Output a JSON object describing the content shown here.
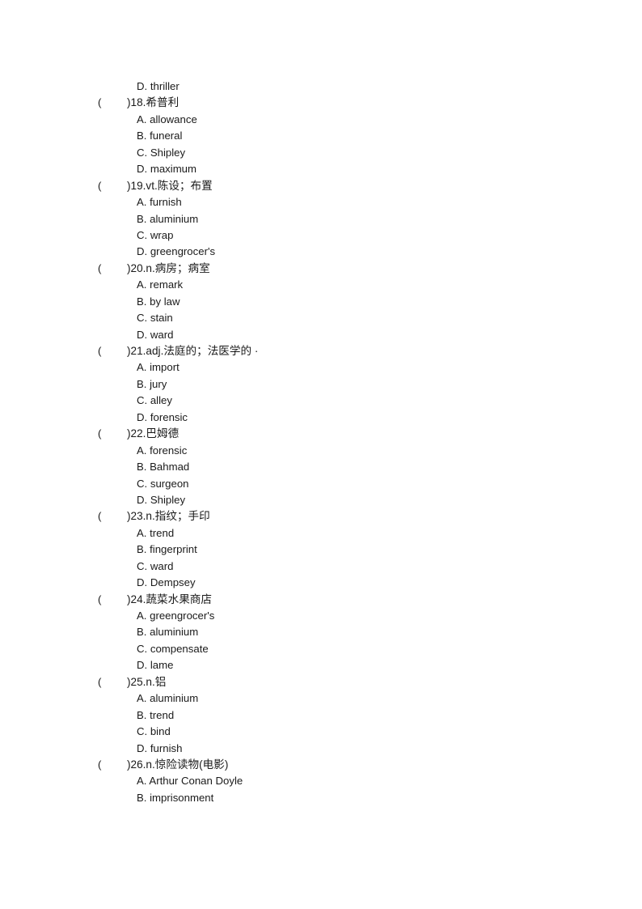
{
  "document": {
    "type": "vocabulary-multiple-choice-worksheet",
    "page_background": "#ffffff",
    "text_color": "#1a1a1a",
    "orphan_option": {
      "label": "D.",
      "text": "D. thriller"
    },
    "questions": [
      {
        "paren_open": "(",
        "paren_close": ")",
        "number": "18.",
        "pos": "",
        "prompt": "希普利",
        "stem": ")18.希普利",
        "options": [
          "A. allowance",
          "B. funeral",
          "C. Shipley",
          "D. maximum"
        ]
      },
      {
        "paren_open": "(",
        "paren_close": ")",
        "number": "19.",
        "pos": "vt.",
        "prompt": "陈设；布置",
        "stem": ")19.vt.陈设；布置",
        "options": [
          "A. furnish",
          "B. aluminium",
          "C. wrap",
          "D. greengrocer's"
        ]
      },
      {
        "paren_open": "(",
        "paren_close": ")",
        "number": "20.",
        "pos": "n.",
        "prompt": "病房；病室",
        "stem": ")20.n.病房；病室",
        "options": [
          "A. remark",
          "B. by law",
          "C. stain",
          "D. ward"
        ]
      },
      {
        "paren_open": "(",
        "paren_close": ")",
        "number": "21.",
        "pos": "adj.",
        "prompt": "法庭的；法医学的 ·",
        "stem": ")21.adj.法庭的；法医学的 ·",
        "options": [
          "A. import",
          "B. jury",
          "C. alley",
          "D. forensic"
        ]
      },
      {
        "paren_open": "(",
        "paren_close": ")",
        "number": "22.",
        "pos": "",
        "prompt": "巴姆德",
        "stem": ")22.巴姆德",
        "options": [
          "A. forensic",
          "B. Bahmad",
          "C. surgeon",
          "D. Shipley"
        ]
      },
      {
        "paren_open": "(",
        "paren_close": ")",
        "number": "23.",
        "pos": "n.",
        "prompt": "指纹；手印",
        "stem": ")23.n.指纹；手印",
        "options": [
          "A. trend",
          "B. fingerprint",
          "C. ward",
          "D. Dempsey"
        ]
      },
      {
        "paren_open": "(",
        "paren_close": ")",
        "number": "24.",
        "pos": "",
        "prompt": "蔬菜水果商店",
        "stem": ")24.蔬菜水果商店",
        "options": [
          "A. greengrocer's",
          "B. aluminium",
          "C. compensate",
          "D. lame"
        ]
      },
      {
        "paren_open": "(",
        "paren_close": ")",
        "number": "25.",
        "pos": "n.",
        "prompt": "铝",
        "stem": ")25.n.铝",
        "options": [
          "A. aluminium",
          "B. trend",
          "C. bind",
          "D. furnish"
        ]
      },
      {
        "paren_open": "(",
        "paren_close": ")",
        "number": "26.",
        "pos": "n.",
        "prompt": "惊险读物(电影)",
        "stem": ")26.n.惊险读物(电影)",
        "options": [
          "A. Arthur Conan Doyle",
          "B. imprisonment"
        ]
      }
    ]
  }
}
